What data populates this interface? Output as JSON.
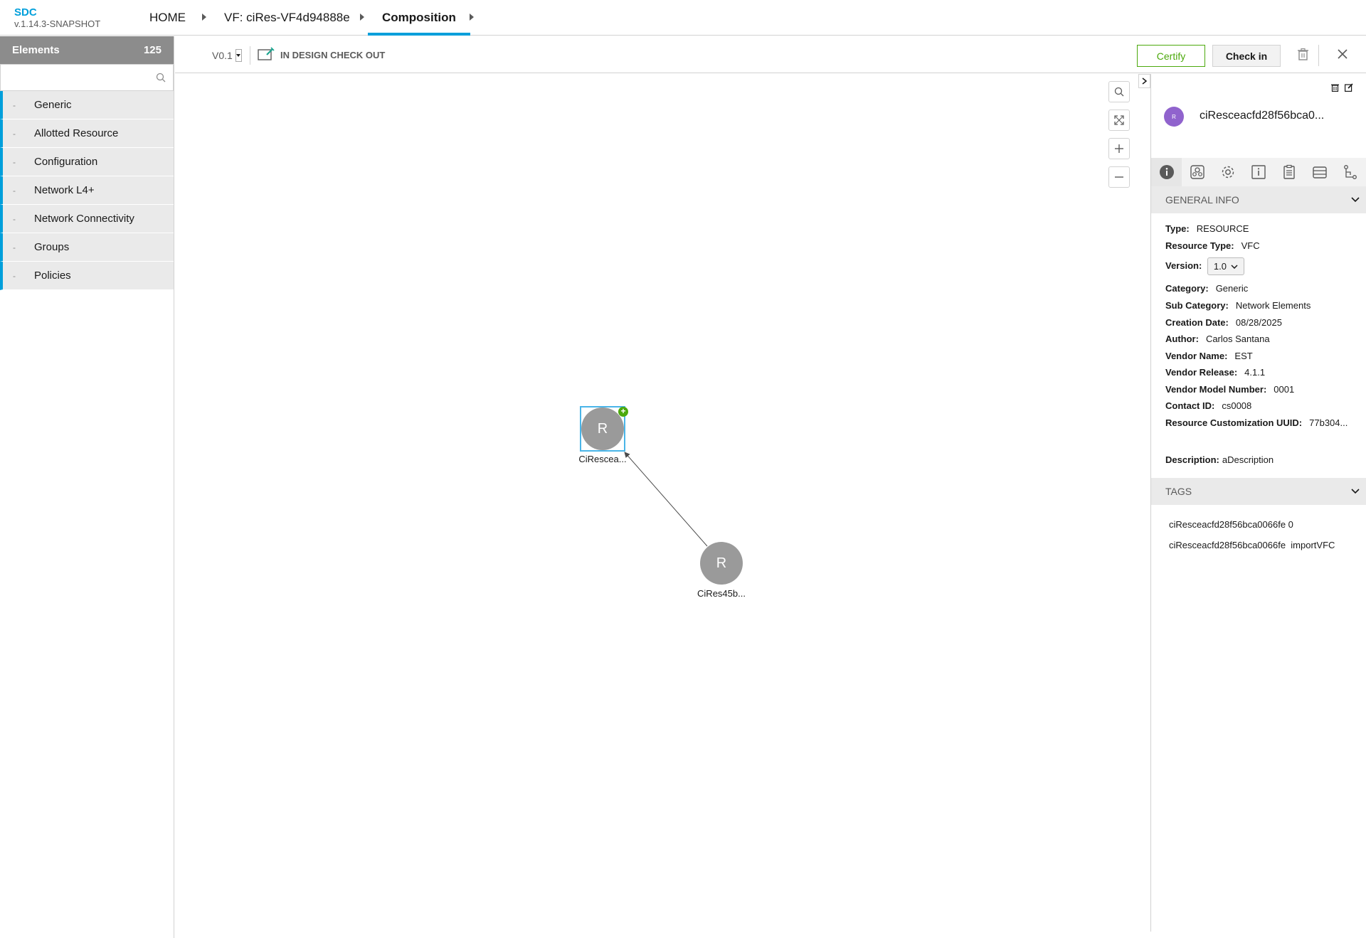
{
  "app": {
    "name": "SDC",
    "version": "v.1.14.3-SNAPSHOT"
  },
  "breadcrumb": {
    "home": "HOME",
    "vf": "VF: ciRes-VF4d94888e",
    "current": "Composition"
  },
  "palette": {
    "title": "Elements",
    "count": "125",
    "search_placeholder": "",
    "categories": [
      "Generic",
      "Allotted Resource",
      "Configuration",
      "Network L4+",
      "Network Connectivity",
      "Groups",
      "Policies"
    ]
  },
  "toolbar": {
    "version": "V0.1",
    "status": "IN DESIGN CHECK OUT",
    "certify_label": "Certify",
    "checkin_label": "Check in"
  },
  "canvas": {
    "nodes": [
      {
        "letter": "R",
        "label": "CiRescea..."
      },
      {
        "letter": "R",
        "label": "CiRes45b..."
      }
    ],
    "badge": "+"
  },
  "panel": {
    "avatar_text": "R",
    "title": "ciResceacfd28f56bca0...",
    "general_info_title": "GENERAL INFO",
    "info": {
      "type_label": "Type:",
      "type": "RESOURCE",
      "resource_type_label": "Resource Type:",
      "resource_type": "VFC",
      "version_label": "Version:",
      "version": "1.0",
      "category_label": "Category:",
      "category": "Generic",
      "sub_category_label": "Sub Category:",
      "sub_category": "Network Elements",
      "creation_date_label": "Creation Date:",
      "creation_date": "08/28/2025",
      "author_label": "Author:",
      "author": "Carlos Santana",
      "vendor_name_label": "Vendor Name:",
      "vendor_name": "EST",
      "vendor_release_label": "Vendor Release:",
      "vendor_release": "4.1.1",
      "vendor_model_label": "Vendor Model Number:",
      "vendor_model": "0001",
      "contact_id_label": "Contact ID:",
      "contact_id": "cs0008",
      "uuid_label": "Resource Customization UUID:",
      "uuid": "77b304...",
      "description_label": "Description:",
      "description": "aDescription"
    },
    "tags_title": "TAGS",
    "tags": [
      "ciResceacfd28f56bca0066fe 0",
      "ciResceacfd28f56bca0066fe  importVFC"
    ]
  }
}
